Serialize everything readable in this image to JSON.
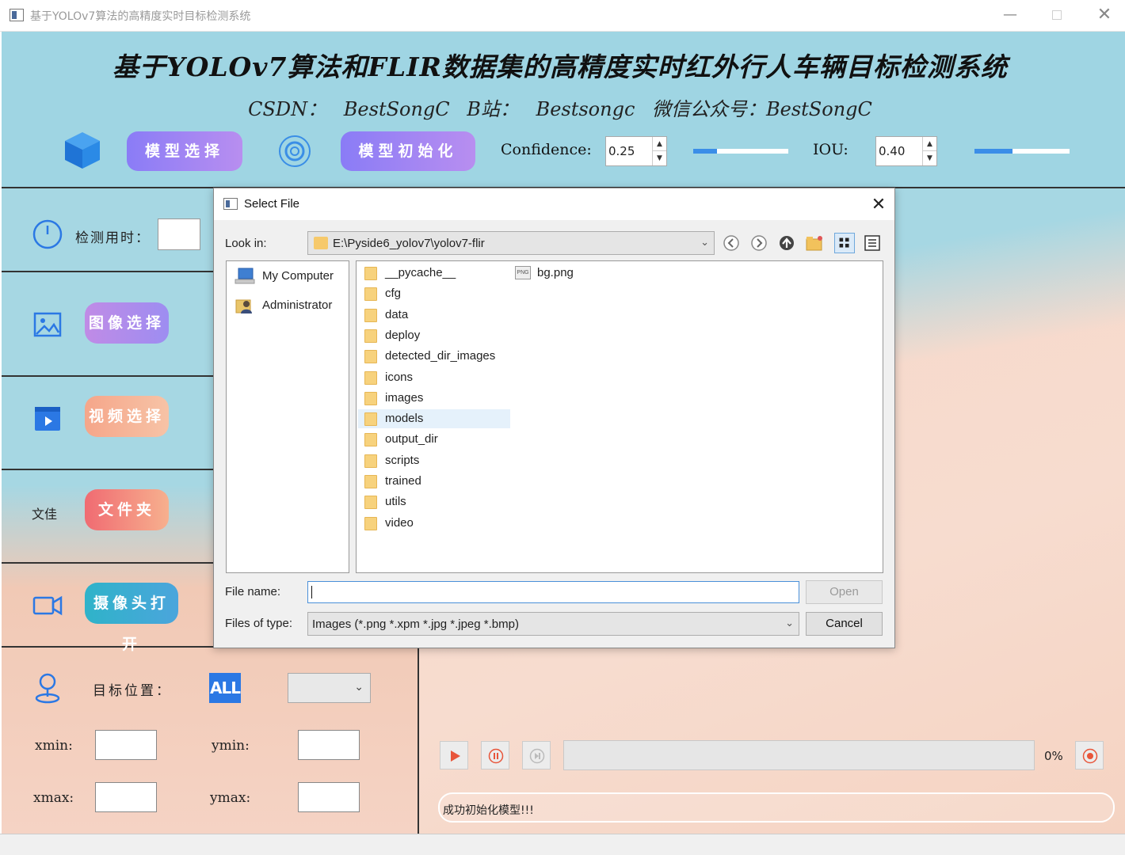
{
  "window": {
    "title": "基于YOLOv7算法的高精度实时目标检测系统"
  },
  "header": {
    "title": "基于YOLOv7算法和FLIR数据集的高精度实时红外行人车辆目标检测系统",
    "subtitle": "CSDN：  BestSongC    B站：  Bestsongc     微信公众号：BestSongC",
    "model_select_label": "模型选择",
    "model_init_label": "模型初始化",
    "confidence_label": "Confidence:",
    "confidence_value": "0.25",
    "confidence_slider": 0.25,
    "iou_label": "IOU:",
    "iou_value": "0.40",
    "iou_slider": 0.4
  },
  "left_panel": {
    "timing_label": "检测用时：",
    "image_select_label": "图像选择",
    "video_select_label": "视频选择",
    "folder_text": "文佳",
    "folder_label": "文件夹",
    "camera_label": "摄像头打开",
    "target_position_label": "目标位置：",
    "all_label": "ALL",
    "xmin_label": "xmin:",
    "ymin_label": "ymin:",
    "xmax_label": "xmax:",
    "ymax_label": "ymax:"
  },
  "right_panel": {
    "progress_percent": "0%",
    "status_text": "成功初始化模型!!!"
  },
  "dialog": {
    "title": "Select File",
    "look_in_label": "Look in:",
    "look_in_path": "E:\\Pyside6_yolov7\\yolov7-flir",
    "sidebar": [
      {
        "label": "My Computer",
        "icon": "computer-icon"
      },
      {
        "label": "Administrator",
        "icon": "user-icon"
      }
    ],
    "folders": [
      "__pycache__",
      "cfg",
      "data",
      "deploy",
      "detected_dir_images",
      "icons",
      "images",
      "models",
      "output_dir",
      "scripts",
      "trained",
      "utils",
      "video"
    ],
    "selected_folder": "models",
    "files": [
      "bg.png"
    ],
    "file_name_label": "File name:",
    "file_name_value": "",
    "files_of_type_label": "Files of type:",
    "files_of_type_value": "Images (*.png *.xpm *.jpg *.jpeg *.bmp)",
    "open_label": "Open",
    "cancel_label": "Cancel"
  }
}
